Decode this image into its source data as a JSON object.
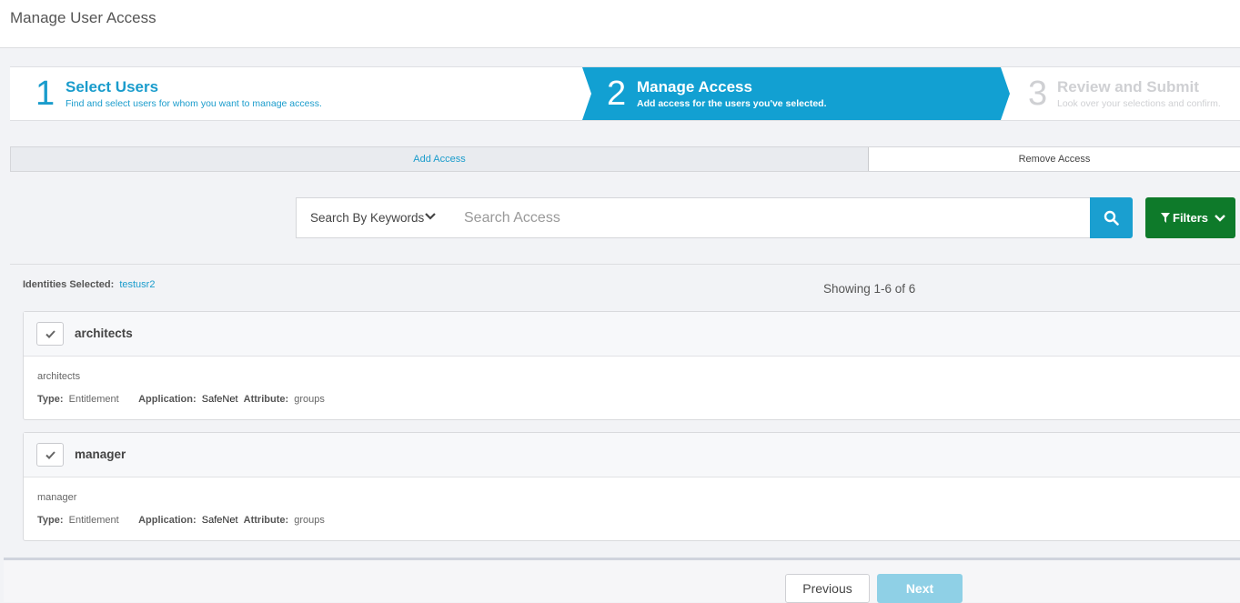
{
  "page": {
    "title": "Manage User Access"
  },
  "wizard": {
    "steps": [
      {
        "number": "1",
        "title": "Select Users",
        "description": "Find and select users for whom you want to manage access."
      },
      {
        "number": "2",
        "title": "Manage Access",
        "description": "Add access for the users you've selected."
      },
      {
        "number": "3",
        "title": "Review and Submit",
        "description": "Look over your selections and confirm."
      }
    ],
    "active_step": 2
  },
  "tabs": {
    "add": "Add Access",
    "remove": "Remove Access",
    "active": "Add Access"
  },
  "search": {
    "mode": "Search By Keywords",
    "placeholder": "Search Access",
    "value": "",
    "filters_label": "Filters"
  },
  "selection": {
    "label": "Identities Selected:",
    "user": "testusr2"
  },
  "results": {
    "showing": "Showing 1-6 of 6"
  },
  "items": [
    {
      "name": "architects",
      "description": "architects",
      "type_label": "Type:",
      "type": "Entitlement",
      "application_label": "Application:",
      "application": "SafeNet",
      "attribute_label": "Attribute:",
      "attribute": "groups"
    },
    {
      "name": "manager",
      "description": "manager",
      "type_label": "Type:",
      "type": "Entitlement",
      "application_label": "Application:",
      "application": "SafeNet",
      "attribute_label": "Attribute:",
      "attribute": "groups"
    }
  ],
  "footer": {
    "previous": "Previous",
    "next": "Next"
  },
  "colors": {
    "accent": "#1a9fd0",
    "filters": "#0e7a2a",
    "next_disabled": "#8fd0e6"
  },
  "icons": {
    "search": "search-icon",
    "filter": "funnel-icon",
    "check": "check-icon",
    "dropdown": "chevron-down-icon"
  }
}
